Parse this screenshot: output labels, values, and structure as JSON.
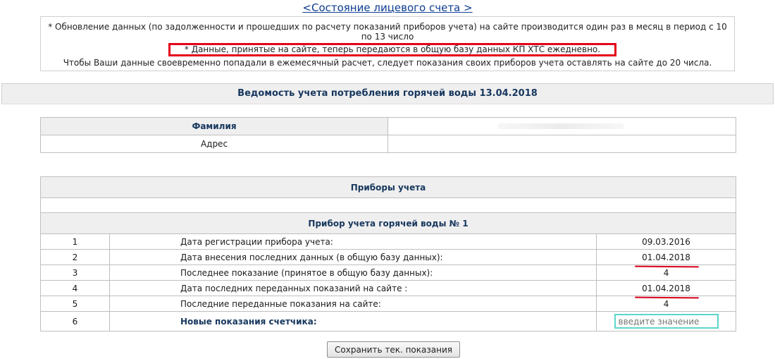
{
  "account_link": "<Состояние лицевого счета >",
  "notice": {
    "line1": "* Обновление данных (по задолженности и прошедших по расчету показаний приборов учета) на сайте производится один раз в месяц в период с 10 по 13 число",
    "line2": "* Данные, принятые на сайте, теперь передаются в общую базу данных КП ХТС ежедневно.",
    "line3": "Чтобы Ваши данные своевременно попадали в ежемесячный расчет, следует показания своих приборов учета оставлять на сайте до 20 числа."
  },
  "statement_title": "Ведомость учета потребления горячей воды 13.04.2018",
  "person": {
    "surname_label": "Фамилия",
    "address_label": "Адрес"
  },
  "devices": {
    "section_title": "Приборы учета",
    "device_title": "Прибор учета горячей воды № 1",
    "rows": [
      {
        "num": "1",
        "label": "Дата регистрации прибора учета:",
        "value": "09.03.2016"
      },
      {
        "num": "2",
        "label": "Дата внесения последних данных (в общую базу данных):",
        "value": "01.04.2018"
      },
      {
        "num": "3",
        "label": "Последнее показание (принятое в общую базу данных):",
        "value": "4"
      },
      {
        "num": "4",
        "label": "Дата последних переданных показаний на сайте :",
        "value": "01.04.2018"
      },
      {
        "num": "5",
        "label": "Последние переданные показания на сайте:",
        "value": "4"
      },
      {
        "num": "6",
        "label": "Новые показания счетчика:",
        "placeholder": "введите значение"
      }
    ]
  },
  "save_button": "Сохранить тек. показания",
  "colors": {
    "link": "#0b3d91",
    "header_text": "#17375e",
    "highlight_border": "#e4001b",
    "input_border": "#5bd6c8"
  }
}
